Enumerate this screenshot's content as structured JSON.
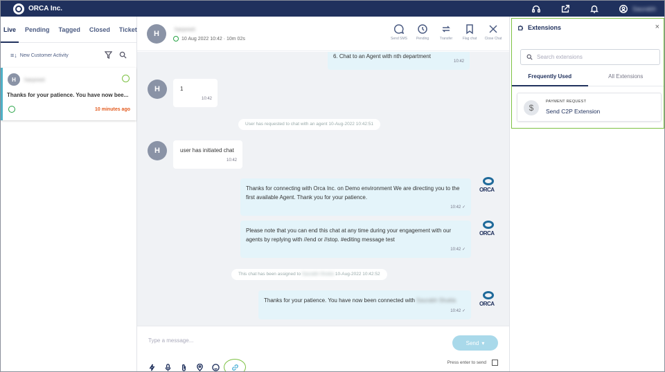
{
  "app": {
    "name": "ORCA Inc.",
    "user_name": "Saurabh"
  },
  "left": {
    "tabs": [
      "Live",
      "Pending",
      "Tagged",
      "Closed",
      "Tickets"
    ],
    "filter_label": "New Customer Activity",
    "chat_card": {
      "initial": "H",
      "name": "harpreet",
      "preview": "Thanks for your patience. You have now bee...",
      "time_ago": "10 minutes ago"
    }
  },
  "header": {
    "initial": "H",
    "name": "harpreet",
    "meta": "10 Aug 2022  10:42 · 10m 02s",
    "actions": [
      "Send SMS",
      "Pending",
      "Transfer",
      "Flag chat",
      "Close Chat"
    ]
  },
  "messages": [
    {
      "text": "6. Chat to an Agent with nth department",
      "time": "10:42"
    },
    {
      "initial": "H",
      "text": "1",
      "time": "10:42"
    },
    {
      "system": "User has requested to chat with an agent 10-Aug-2022 10:42:51"
    },
    {
      "initial": "H",
      "text": "user has initiated chat",
      "time": "10:42"
    },
    {
      "text": "Thanks for connecting with Orca Inc. on Demo environment We are directing you to the first available Agent. Thank you for your patience.",
      "time": "10:42 ✓",
      "sender": "ORCA"
    },
    {
      "text": "Please note that you can end this chat at any time during your engagement with our agents by replying with //end or //stop. #editing message test",
      "time": "10:42 ✓",
      "sender": "ORCA"
    },
    {
      "system_prefix": "This chat has been assigned to",
      "system_agent": "Saurabh Shukla",
      "system_suffix": "10-Aug-2022 10:42:52"
    },
    {
      "text": "Thanks for your patience. You have now been connected with",
      "agent": "Saurabh Shukla",
      "time": "10:42 ✓",
      "sender": "ORCA"
    }
  ],
  "composer": {
    "placeholder": "Type a message...",
    "send_label": "Send",
    "press_enter_label": "Press enter to send"
  },
  "extensions": {
    "title": "Extensions",
    "search_placeholder": "Search extensions",
    "tabs": [
      "Frequently Used",
      "All Extensions"
    ],
    "card": {
      "category": "PAYMENT REQUEST",
      "name": "Send C2P Extension",
      "icon": "$"
    }
  },
  "colors": {
    "navbar": "#20315d",
    "accent": "#4fb0c6",
    "highlight": "#7cc142",
    "warning": "#e35b1f"
  }
}
